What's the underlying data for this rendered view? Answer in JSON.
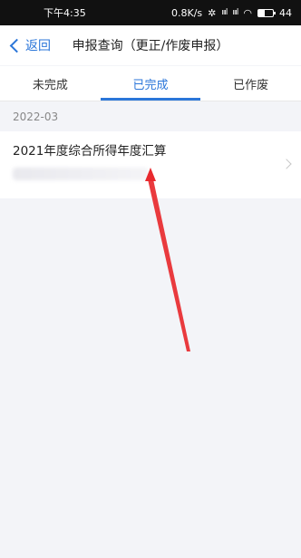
{
  "status_bar": {
    "time": "下午4:35",
    "speed": "0.8K/s",
    "signal1": "ıııl",
    "signal2": "ıııl",
    "battery": "44"
  },
  "navbar": {
    "back_label": "返回",
    "title": "申报查询（更正/作废申报）"
  },
  "tabs": [
    {
      "label": "未完成"
    },
    {
      "label": "已完成",
      "active": true
    },
    {
      "label": "已作废"
    }
  ],
  "records_group": {
    "date": "2022-03",
    "items": [
      {
        "title": "2021年度综合所得年度汇算"
      }
    ]
  },
  "colors": {
    "accent": "#2b76d9",
    "arrow": "#e8292e"
  }
}
